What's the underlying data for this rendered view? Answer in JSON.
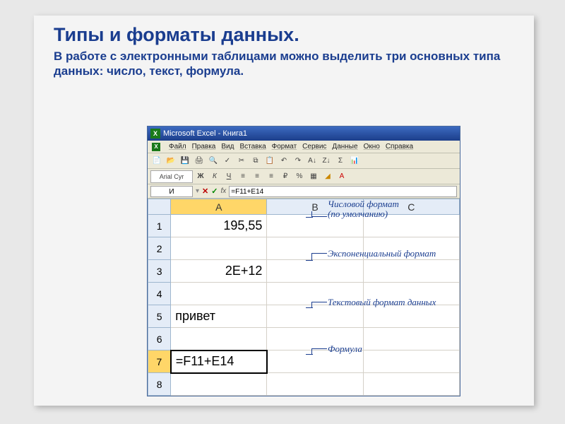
{
  "slide": {
    "title": "Типы и форматы данных.",
    "subtitle_prefix": "В работе с электронными таблицами можно выделить три основных типа данных: ",
    "type1": "число",
    "sep1": ", ",
    "type2": "текст",
    "sep2": ", ",
    "type3": "формула",
    "period": "."
  },
  "excel": {
    "titlebar": "Microsoft Excel - Книга1",
    "menu": {
      "file": "Файл",
      "edit": "Правка",
      "view": "Вид",
      "insert": "Вставка",
      "format": "Формат",
      "tools": "Сервис",
      "data": "Данные",
      "window": "Окно",
      "help": "Справка"
    },
    "font_name": "Arial Cyr",
    "name_box": "И",
    "formula": "=F11+E14",
    "columns": {
      "A": "A",
      "B": "B",
      "C": "C"
    },
    "rows": [
      "1",
      "2",
      "3",
      "4",
      "5",
      "6",
      "7",
      "8"
    ],
    "cells": {
      "A1": "195,55",
      "A3": "2E+12",
      "A5": "привет",
      "A7": "=F11+E14"
    }
  },
  "annotations": {
    "a1_l1": "Числовой формат",
    "a1_l2": "(по умолчанию)",
    "a2": "Экспоненциальный формат",
    "a3": "Текстовый формат данных",
    "a4": "Формула"
  }
}
